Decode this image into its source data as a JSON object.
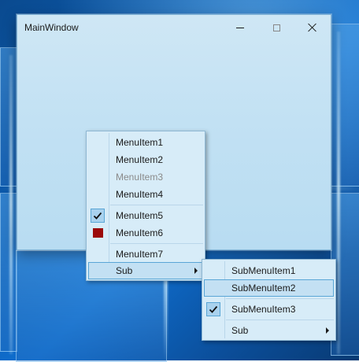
{
  "window": {
    "title": "MainWindow",
    "minimize_icon": "minimize-icon",
    "maximize_icon": "maximize-icon",
    "close_icon": "close-icon"
  },
  "context_menu": {
    "items": [
      {
        "label": "MenuItem1",
        "enabled": true
      },
      {
        "label": "MenuItem2",
        "enabled": true
      },
      {
        "label": "MenuItem3",
        "enabled": false
      },
      {
        "label": "MenuItem4",
        "enabled": true
      },
      {
        "label": "MenuItem5",
        "enabled": true,
        "icon": "checkmark-icon",
        "checked": true
      },
      {
        "label": "MenuItem6",
        "enabled": true,
        "icon": "red-square-icon"
      },
      {
        "label": "MenuItem7",
        "enabled": true
      },
      {
        "label": "Sub",
        "enabled": true,
        "has_submenu": true,
        "highlighted": true
      }
    ]
  },
  "submenu": {
    "items": [
      {
        "label": "SubMenuItem1",
        "enabled": true
      },
      {
        "label": "SubMenuItem2",
        "enabled": true,
        "highlighted": true
      },
      {
        "label": "SubMenuItem3",
        "enabled": true,
        "icon": "checkmark-icon",
        "checked": true
      },
      {
        "label": "Sub",
        "enabled": true,
        "has_submenu": true
      }
    ]
  },
  "colors": {
    "highlight_fill": "#c3e0f3",
    "highlight_border": "#5aa6d6",
    "square_icon": "#9b0a0a",
    "disabled_text": "#8a8a8a"
  }
}
